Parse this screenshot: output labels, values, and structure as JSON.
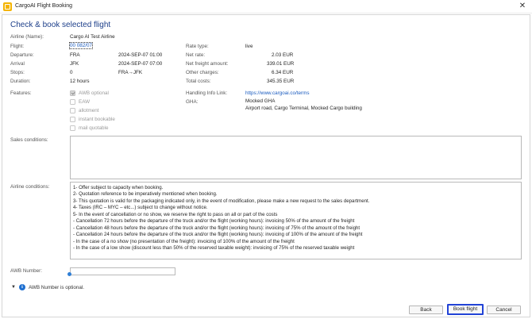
{
  "window": {
    "title": "CargoAI Flight Booking",
    "close_glyph": "✕",
    "app_icon": "cargoai-logo-icon"
  },
  "heading": "Check & book selected flight",
  "left": {
    "airline_label": "Airline (Name):",
    "airline_value": "Cargo AI Test Airline",
    "flight_label": "Flight:",
    "flight_value": "00 082/07",
    "departure_label": "Departure:",
    "departure_airport": "FRA",
    "departure_time": "2024-SEP-07 01:00",
    "arrival_label": "Arrival",
    "arrival_airport": "JFK",
    "arrival_time": "2024-SEP-07 07:00",
    "stops_label": "Stops:",
    "stops_value": "0",
    "route_value": "FRA→JFK",
    "duration_label": "Duration:",
    "duration_value": "12 hours",
    "features_label": "Features:",
    "features": [
      {
        "label": "AWB optional",
        "checked": true
      },
      {
        "label": "EAW",
        "checked": false
      },
      {
        "label": "allotment",
        "checked": false
      },
      {
        "label": "instant bookable",
        "checked": false
      },
      {
        "label": "mail quotable",
        "checked": false
      }
    ]
  },
  "right": {
    "rate_type_label": "Rate type:",
    "rate_type_value": "live",
    "net_rate_label": "Net rate:",
    "net_rate_value": "2.03 EUR",
    "net_freight_label": "Net freight amount:",
    "net_freight_value": "339.01 EUR",
    "other_charges_label": "Other charges:",
    "other_charges_value": "6.34 EUR",
    "total_costs_label": "Total costs:",
    "total_costs_value": "345.35 EUR",
    "handling_label": "Handling Info Link:",
    "handling_link": "https://www.cargoai.co/terms",
    "gha_label": "GHA:",
    "gha_name": "Mocked GHA",
    "gha_address": "Airport road, Cargo Terminal, Mocked Cargo building"
  },
  "sales_conditions_label": "Sales conditions:",
  "airline_conditions_label": "Airline conditions:",
  "airline_conditions": [
    "1- Offer subject to capacity when booking.",
    "2- Quotation reference to be imperatively mentioned when booking.",
    "3- This quotation is valid for the packaging indicated only, in the event of modification, please make a new request to the sales department.",
    "4- Taxes (IRC – MYC – etc...) subject to change without notice.",
    "5- In the event of cancellation or no show, we reserve the right to pass on all or part of the costs",
    "- Cancellation 72 hours before the departure of the truck and/or the flight (working hours): invoicing 50% of the amount of the freight",
    "- Cancellation 48 hours before the departure of the truck and/or the flight (working hours): invoicing of 75% of the amount of the freight",
    "- Cancellation 24 hours before the departure of the truck and/or the flight (working hours): invoicing of 100% of the amount of the freight",
    "- In the case of a no show (no presentation of the freight): invoicing of 100% of the amount of the freight",
    "- In the case of a low show (discount less than 50% of the reserved taxable weight): invoicing of 75% of the reserved taxable weight"
  ],
  "awb": {
    "label": "AWB Number:",
    "value": "",
    "info": "AWB Number is optional."
  },
  "buttons": {
    "back": "Back",
    "book": "Book flight",
    "cancel": "Cancel"
  }
}
